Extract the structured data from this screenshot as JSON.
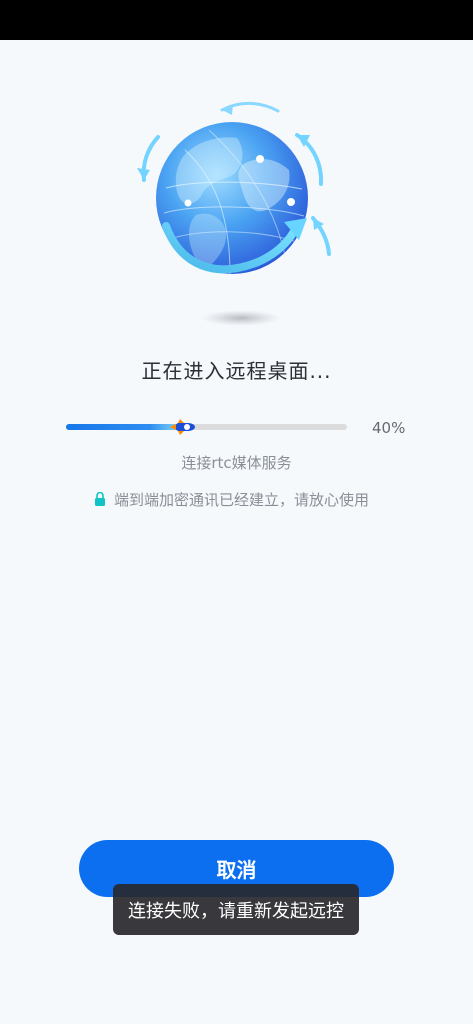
{
  "screen": {
    "title": "正在进入远程桌面...",
    "progress": {
      "value_percent": 40,
      "label": "40%"
    },
    "subtitle": "连接rtc媒体服务",
    "secure_message": "端到端加密通讯已经建立，请放心使用",
    "cancel_label": "取消",
    "toast": "连接失败，请重新发起远控"
  },
  "icons": {
    "globe": "globe-icon",
    "rocket": "rocket-icon",
    "lock": "lock-icon"
  },
  "colors": {
    "accent": "#0b6ff0",
    "progress_track": "#dcdcdc",
    "secure_lock": "#11c3c8",
    "toast_bg": "#28282c"
  }
}
